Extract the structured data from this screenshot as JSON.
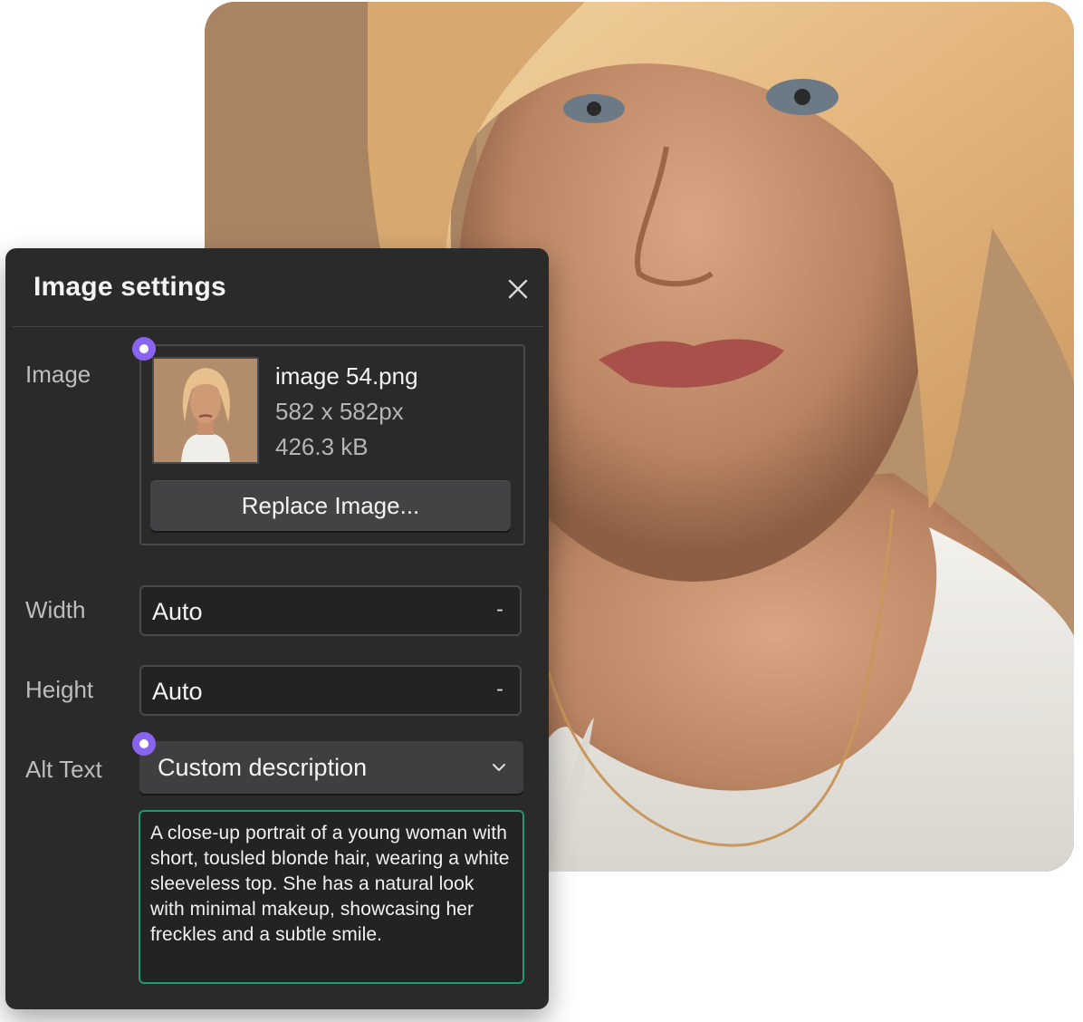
{
  "panel": {
    "title": "Image settings",
    "close_icon": "close-icon"
  },
  "image": {
    "label": "Image",
    "file_name": "image 54.png",
    "dimensions": "582 x 582px",
    "file_size": "426.3 kB",
    "replace_label": "Replace Image..."
  },
  "width": {
    "label": "Width",
    "value": "Auto",
    "unit": "-"
  },
  "height": {
    "label": "Height",
    "value": "Auto",
    "unit": "-"
  },
  "alt_text": {
    "label": "Alt Text",
    "mode": "Custom description",
    "chevron_icon": "chevron-down-icon",
    "description": "A close-up portrait of a young woman with short, tousled blonde hair, wearing a white sleeveless top. She has a natural look with minimal makeup, showcasing her freckles and a subtle smile."
  },
  "colors": {
    "panel_bg": "#2a2a2b",
    "accent_marker": "#8a63f0",
    "focus_border": "#1f9a72"
  }
}
